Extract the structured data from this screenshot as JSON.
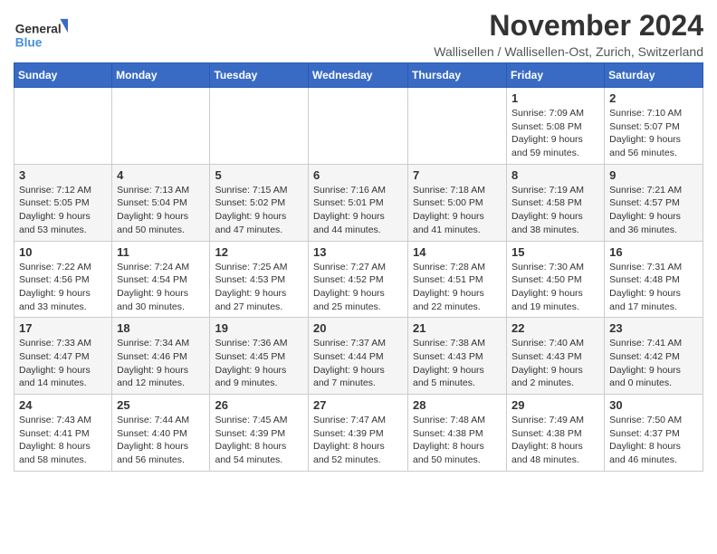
{
  "logo": {
    "line1": "General",
    "line2": "Blue"
  },
  "title": "November 2024",
  "subtitle": "Wallisellen / Wallisellen-Ost, Zurich, Switzerland",
  "headers": [
    "Sunday",
    "Monday",
    "Tuesday",
    "Wednesday",
    "Thursday",
    "Friday",
    "Saturday"
  ],
  "weeks": [
    [
      {
        "day": "",
        "info": ""
      },
      {
        "day": "",
        "info": ""
      },
      {
        "day": "",
        "info": ""
      },
      {
        "day": "",
        "info": ""
      },
      {
        "day": "",
        "info": ""
      },
      {
        "day": "1",
        "info": "Sunrise: 7:09 AM\nSunset: 5:08 PM\nDaylight: 9 hours and 59 minutes."
      },
      {
        "day": "2",
        "info": "Sunrise: 7:10 AM\nSunset: 5:07 PM\nDaylight: 9 hours and 56 minutes."
      }
    ],
    [
      {
        "day": "3",
        "info": "Sunrise: 7:12 AM\nSunset: 5:05 PM\nDaylight: 9 hours and 53 minutes."
      },
      {
        "day": "4",
        "info": "Sunrise: 7:13 AM\nSunset: 5:04 PM\nDaylight: 9 hours and 50 minutes."
      },
      {
        "day": "5",
        "info": "Sunrise: 7:15 AM\nSunset: 5:02 PM\nDaylight: 9 hours and 47 minutes."
      },
      {
        "day": "6",
        "info": "Sunrise: 7:16 AM\nSunset: 5:01 PM\nDaylight: 9 hours and 44 minutes."
      },
      {
        "day": "7",
        "info": "Sunrise: 7:18 AM\nSunset: 5:00 PM\nDaylight: 9 hours and 41 minutes."
      },
      {
        "day": "8",
        "info": "Sunrise: 7:19 AM\nSunset: 4:58 PM\nDaylight: 9 hours and 38 minutes."
      },
      {
        "day": "9",
        "info": "Sunrise: 7:21 AM\nSunset: 4:57 PM\nDaylight: 9 hours and 36 minutes."
      }
    ],
    [
      {
        "day": "10",
        "info": "Sunrise: 7:22 AM\nSunset: 4:56 PM\nDaylight: 9 hours and 33 minutes."
      },
      {
        "day": "11",
        "info": "Sunrise: 7:24 AM\nSunset: 4:54 PM\nDaylight: 9 hours and 30 minutes."
      },
      {
        "day": "12",
        "info": "Sunrise: 7:25 AM\nSunset: 4:53 PM\nDaylight: 9 hours and 27 minutes."
      },
      {
        "day": "13",
        "info": "Sunrise: 7:27 AM\nSunset: 4:52 PM\nDaylight: 9 hours and 25 minutes."
      },
      {
        "day": "14",
        "info": "Sunrise: 7:28 AM\nSunset: 4:51 PM\nDaylight: 9 hours and 22 minutes."
      },
      {
        "day": "15",
        "info": "Sunrise: 7:30 AM\nSunset: 4:50 PM\nDaylight: 9 hours and 19 minutes."
      },
      {
        "day": "16",
        "info": "Sunrise: 7:31 AM\nSunset: 4:48 PM\nDaylight: 9 hours and 17 minutes."
      }
    ],
    [
      {
        "day": "17",
        "info": "Sunrise: 7:33 AM\nSunset: 4:47 PM\nDaylight: 9 hours and 14 minutes."
      },
      {
        "day": "18",
        "info": "Sunrise: 7:34 AM\nSunset: 4:46 PM\nDaylight: 9 hours and 12 minutes."
      },
      {
        "day": "19",
        "info": "Sunrise: 7:36 AM\nSunset: 4:45 PM\nDaylight: 9 hours and 9 minutes."
      },
      {
        "day": "20",
        "info": "Sunrise: 7:37 AM\nSunset: 4:44 PM\nDaylight: 9 hours and 7 minutes."
      },
      {
        "day": "21",
        "info": "Sunrise: 7:38 AM\nSunset: 4:43 PM\nDaylight: 9 hours and 5 minutes."
      },
      {
        "day": "22",
        "info": "Sunrise: 7:40 AM\nSunset: 4:43 PM\nDaylight: 9 hours and 2 minutes."
      },
      {
        "day": "23",
        "info": "Sunrise: 7:41 AM\nSunset: 4:42 PM\nDaylight: 9 hours and 0 minutes."
      }
    ],
    [
      {
        "day": "24",
        "info": "Sunrise: 7:43 AM\nSunset: 4:41 PM\nDaylight: 8 hours and 58 minutes."
      },
      {
        "day": "25",
        "info": "Sunrise: 7:44 AM\nSunset: 4:40 PM\nDaylight: 8 hours and 56 minutes."
      },
      {
        "day": "26",
        "info": "Sunrise: 7:45 AM\nSunset: 4:39 PM\nDaylight: 8 hours and 54 minutes."
      },
      {
        "day": "27",
        "info": "Sunrise: 7:47 AM\nSunset: 4:39 PM\nDaylight: 8 hours and 52 minutes."
      },
      {
        "day": "28",
        "info": "Sunrise: 7:48 AM\nSunset: 4:38 PM\nDaylight: 8 hours and 50 minutes."
      },
      {
        "day": "29",
        "info": "Sunrise: 7:49 AM\nSunset: 4:38 PM\nDaylight: 8 hours and 48 minutes."
      },
      {
        "day": "30",
        "info": "Sunrise: 7:50 AM\nSunset: 4:37 PM\nDaylight: 8 hours and 46 minutes."
      }
    ]
  ]
}
